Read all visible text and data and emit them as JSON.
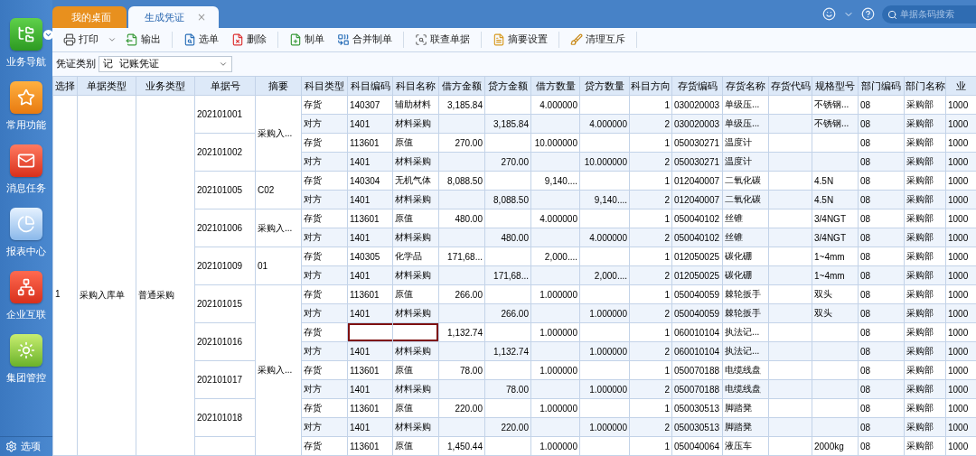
{
  "sidebar": {
    "items": [
      {
        "label": "业务导航",
        "has_menu": true
      },
      {
        "label": "常用功能",
        "has_menu": false
      },
      {
        "label": "消息任务",
        "has_menu": false
      },
      {
        "label": "报表中心",
        "has_menu": false
      },
      {
        "label": "企业互联",
        "has_menu": false
      },
      {
        "label": "集团管控",
        "has_menu": false
      }
    ],
    "footer": "选项"
  },
  "tabs": [
    {
      "label": "我的桌面",
      "selected": false,
      "closable": false
    },
    {
      "label": "生成凭证",
      "selected": true,
      "closable": true
    }
  ],
  "header": {
    "close_glyph": "×",
    "search": {
      "placeholder": "单据条码搜索"
    }
  },
  "toolbar": {
    "groups": [
      [
        {
          "label": "打印",
          "has_menu": true
        },
        {
          "label": "输出",
          "has_menu": false
        }
      ],
      [
        {
          "label": "选单",
          "has_menu": false
        },
        {
          "label": "删除",
          "has_menu": false
        }
      ],
      [
        {
          "label": "制单",
          "has_menu": false
        },
        {
          "label": "合并制单",
          "has_menu": false
        }
      ],
      [
        {
          "label": "联查单据",
          "has_menu": false
        }
      ],
      [
        {
          "label": "摘要设置",
          "has_menu": false
        }
      ],
      [
        {
          "label": "清理互斥",
          "has_menu": false
        }
      ]
    ]
  },
  "filter": {
    "label": "凭证类别",
    "value": "记  记账凭证"
  },
  "table": {
    "columns": [
      "选择",
      "单据类型",
      "业务类型",
      "单据号",
      "摘要",
      "科目类型",
      "科目编码",
      "科目名称",
      "借方金额",
      "贷方金额",
      "借方数量",
      "贷方数量",
      "科目方向",
      "存货编码",
      "存货名称",
      "存货代码",
      "规格型号",
      "部门编码",
      "部门名称",
      "业"
    ],
    "select": "1",
    "doc_type": "采购入库单",
    "biz_type": "普通采购",
    "groups": [
      {
        "summary": "采购入...",
        "documents": [
          {
            "number": "202101001",
            "lines": [
              {
                "cells": [
                  "存货",
                  "140307",
                  "辅助材料",
                  "3,185.84",
                  "",
                  "4.000000",
                  "",
                  "1",
                  "030020003",
                  "单级压...",
                  "",
                  "不锈钢...",
                  "08",
                  "采购部",
                  "1000"
                ],
                "focused": false
              },
              {
                "cells": [
                  "对方",
                  "1401",
                  "材料采购",
                  "",
                  "3,185.84",
                  "",
                  "4.000000",
                  "2",
                  "030020003",
                  "单级压...",
                  "",
                  "不锈钢...",
                  "08",
                  "采购部",
                  "1000"
                ],
                "focused": false
              }
            ]
          },
          {
            "number": "202101002",
            "lines": [
              {
                "cells": [
                  "存货",
                  "113601",
                  "原值",
                  "270.00",
                  "",
                  "10.000000",
                  "",
                  "1",
                  "050030271",
                  "温度计",
                  "",
                  "",
                  "08",
                  "采购部",
                  "1000"
                ],
                "focused": false
              },
              {
                "cells": [
                  "对方",
                  "1401",
                  "材料采购",
                  "",
                  "270.00",
                  "",
                  "10.000000",
                  "2",
                  "050030271",
                  "温度计",
                  "",
                  "",
                  "08",
                  "采购部",
                  "1000"
                ],
                "focused": false
              }
            ]
          }
        ]
      },
      {
        "summary": "C02",
        "documents": [
          {
            "number": "202101005",
            "lines": [
              {
                "cells": [
                  "存货",
                  "140304",
                  "无机气体",
                  "8,088.50",
                  "",
                  "9,140....",
                  "",
                  "1",
                  "012040007",
                  "二氧化碳",
                  "",
                  "4.5N",
                  "08",
                  "采购部",
                  "1000"
                ],
                "focused": false
              },
              {
                "cells": [
                  "对方",
                  "1401",
                  "材料采购",
                  "",
                  "8,088.50",
                  "",
                  "9,140....",
                  "2",
                  "012040007",
                  "二氧化碳",
                  "",
                  "4.5N",
                  "08",
                  "采购部",
                  "1000"
                ],
                "focused": false
              }
            ]
          }
        ]
      },
      {
        "summary": "采购入...",
        "documents": [
          {
            "number": "202101006",
            "lines": [
              {
                "cells": [
                  "存货",
                  "113601",
                  "原值",
                  "480.00",
                  "",
                  "4.000000",
                  "",
                  "1",
                  "050040102",
                  "丝锥",
                  "",
                  "3/4NGT",
                  "08",
                  "采购部",
                  "1000"
                ],
                "focused": false
              },
              {
                "cells": [
                  "对方",
                  "1401",
                  "材料采购",
                  "",
                  "480.00",
                  "",
                  "4.000000",
                  "2",
                  "050040102",
                  "丝锥",
                  "",
                  "3/4NGT",
                  "08",
                  "采购部",
                  "1000"
                ],
                "focused": false
              }
            ]
          }
        ]
      },
      {
        "summary": "01",
        "documents": [
          {
            "number": "202101009",
            "lines": [
              {
                "cells": [
                  "存货",
                  "140305",
                  "化学品",
                  "171,68...",
                  "",
                  "2,000....",
                  "",
                  "1",
                  "012050025",
                  "碳化硼",
                  "",
                  "1~4mm",
                  "08",
                  "采购部",
                  "1000"
                ],
                "focused": false
              },
              {
                "cells": [
                  "对方",
                  "1401",
                  "材料采购",
                  "",
                  "171,68...",
                  "",
                  "2,000....",
                  "2",
                  "012050025",
                  "碳化硼",
                  "",
                  "1~4mm",
                  "08",
                  "采购部",
                  "1000"
                ],
                "focused": false
              }
            ]
          }
        ]
      },
      {
        "summary": "采购入...",
        "documents": [
          {
            "number": "202101015",
            "lines": [
              {
                "cells": [
                  "存货",
                  "113601",
                  "原值",
                  "266.00",
                  "",
                  "1.000000",
                  "",
                  "1",
                  "050040059",
                  "棘轮扳手",
                  "",
                  "双头",
                  "08",
                  "采购部",
                  "1000"
                ],
                "focused": false
              },
              {
                "cells": [
                  "对方",
                  "1401",
                  "材料采购",
                  "",
                  "266.00",
                  "",
                  "1.000000",
                  "2",
                  "050040059",
                  "棘轮扳手",
                  "",
                  "双头",
                  "08",
                  "采购部",
                  "1000"
                ],
                "focused": false
              }
            ]
          },
          {
            "number": "202101016",
            "lines": [
              {
                "cells": [
                  "存货",
                  "",
                  "",
                  "1,132.74",
                  "",
                  "1.000000",
                  "",
                  "1",
                  "060010104",
                  "执法记...",
                  "",
                  "",
                  "08",
                  "采购部",
                  "1000"
                ],
                "focused": true
              },
              {
                "cells": [
                  "对方",
                  "1401",
                  "材料采购",
                  "",
                  "1,132.74",
                  "",
                  "1.000000",
                  "2",
                  "060010104",
                  "执法记...",
                  "",
                  "",
                  "08",
                  "采购部",
                  "1000"
                ],
                "focused": false
              }
            ]
          },
          {
            "number": "202101017",
            "lines": [
              {
                "cells": [
                  "存货",
                  "113601",
                  "原值",
                  "78.00",
                  "",
                  "1.000000",
                  "",
                  "1",
                  "050070188",
                  "电缆线盘",
                  "",
                  "",
                  "08",
                  "采购部",
                  "1000"
                ],
                "focused": false
              },
              {
                "cells": [
                  "对方",
                  "1401",
                  "材料采购",
                  "",
                  "78.00",
                  "",
                  "1.000000",
                  "2",
                  "050070188",
                  "电缆线盘",
                  "",
                  "",
                  "08",
                  "采购部",
                  "1000"
                ],
                "focused": false
              }
            ]
          },
          {
            "number": "202101018",
            "lines": [
              {
                "cells": [
                  "存货",
                  "113601",
                  "原值",
                  "220.00",
                  "",
                  "1.000000",
                  "",
                  "1",
                  "050030513",
                  "脚踏凳",
                  "",
                  "",
                  "08",
                  "采购部",
                  "1000"
                ],
                "focused": false
              },
              {
                "cells": [
                  "对方",
                  "1401",
                  "材料采购",
                  "",
                  "220.00",
                  "",
                  "1.000000",
                  "2",
                  "050030513",
                  "脚踏凳",
                  "",
                  "",
                  "08",
                  "采购部",
                  "1000"
                ],
                "focused": false
              }
            ]
          },
          {
            "lines": [
              {
                "cells": [
                  "存货",
                  "113601",
                  "原值",
                  "1,450.44",
                  "",
                  "1.000000",
                  "",
                  "1",
                  "050040064",
                  "液压车",
                  "",
                  "2000kg",
                  "08",
                  "采购部",
                  "1000"
                ],
                "focused": false
              }
            ]
          }
        ]
      }
    ]
  }
}
